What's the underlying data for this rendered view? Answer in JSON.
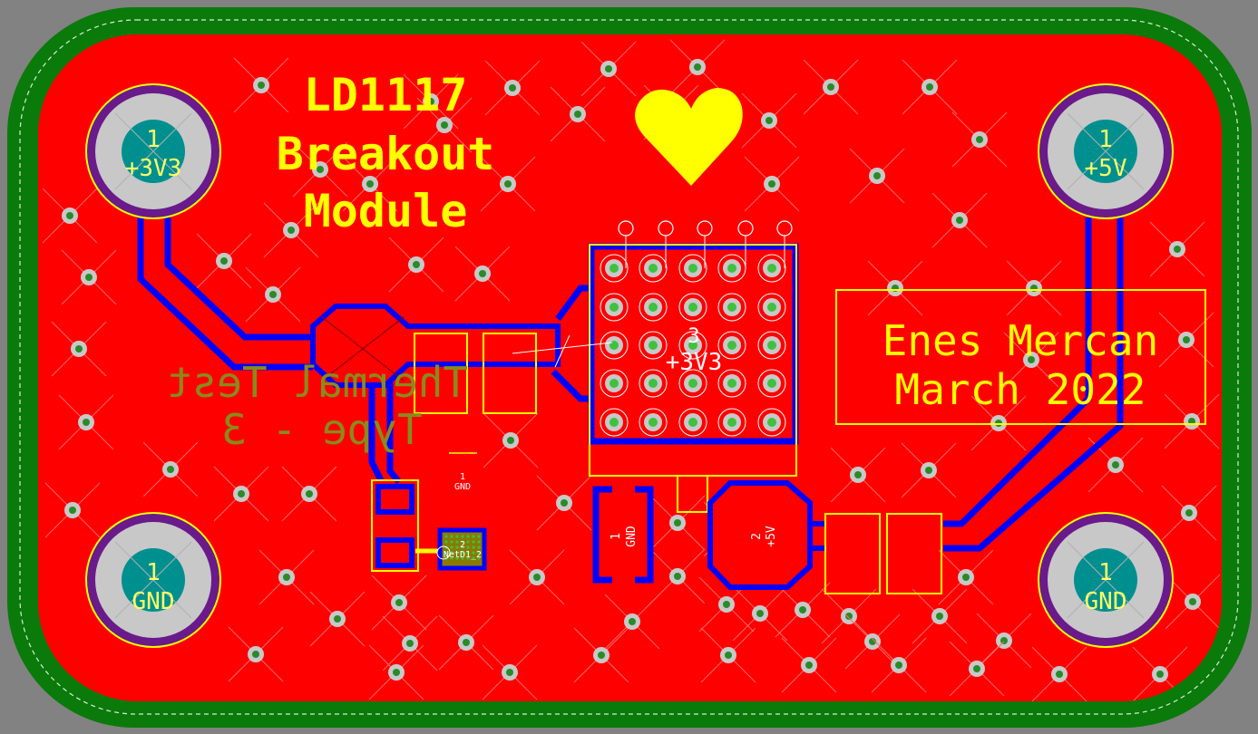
{
  "title": {
    "line1": "LD1117",
    "line2": "Breakout",
    "line3": "Module"
  },
  "author": {
    "name": "Enes Mercan",
    "date": "March 2022"
  },
  "mirrored_note": {
    "line1": "Thermal Test",
    "line2": "Type - 3"
  },
  "pads": {
    "tl": {
      "number": "1",
      "net": "+3V3"
    },
    "tr": {
      "number": "1",
      "net": "+5V"
    },
    "bl": {
      "number": "1",
      "net": "GND"
    },
    "br": {
      "number": "1",
      "net": "GND"
    }
  },
  "regulator": {
    "pin3_number": "3",
    "pin3_net": "+3V3",
    "pin1_number": "1",
    "pin1_net": "GND",
    "pin2_number": "2",
    "pin2_net": "+5V"
  },
  "small_pads": {
    "gnd_number": "1",
    "gnd_net": "GND",
    "led_number": "2",
    "led_net": "NetD1_2"
  },
  "colors": {
    "background": "#828282",
    "outline_green": "#0a7a0a",
    "copper_red": "#ff0000",
    "trace_blue": "#0000ff",
    "silkscreen_yellow": "#ffff00",
    "via_ring": "#c8c8c8",
    "via_hole": "#2a8a2a",
    "pad_teal": "#008f8f",
    "olive_text": "#8a8a1a"
  }
}
